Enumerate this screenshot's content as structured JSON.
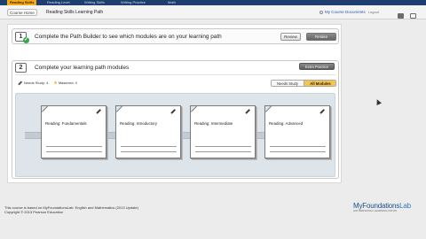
{
  "topbar": {
    "tabs": [
      {
        "label": "Reading Skills",
        "active": true
      },
      {
        "label": "Reading Level",
        "active": false
      },
      {
        "label": "Writing Skills",
        "active": false
      },
      {
        "label": "Writing Practice",
        "active": false
      },
      {
        "label": "Math",
        "active": false
      }
    ]
  },
  "subheader": {
    "course_home": "Course Home",
    "title": "Reading Skills Learning Path",
    "course_docs": "My Course Documents",
    "logout": "Logout"
  },
  "step1": {
    "number": "1",
    "text": "Complete the Path Builder to see which modules are on your learning path",
    "review": "Review",
    "retake": "Retake"
  },
  "step2": {
    "number": "2",
    "text": "Complete your learning path modules",
    "extra_practice": "Extra Practice",
    "needs_study_label": "Needs Study: 4",
    "mastered_label": "Mastered: 0",
    "filter_needs_study": "Needs Study",
    "filter_all": "All Modules",
    "modules": [
      {
        "name": "Reading: Fundamentals"
      },
      {
        "name": "Reading: Introductory"
      },
      {
        "name": "Reading: Intermediate"
      },
      {
        "name": "Reading: Advanced"
      }
    ]
  },
  "footer": {
    "line1": "This course is based on MyFoundationsLab: English and Mathematics (2013 Update)",
    "line2": "Copyright © 2013 Pearson Education"
  },
  "brand": {
    "name_a": "MyFoundations",
    "name_b": "Lab",
    "tagline": "with PERSONAL LEARNING PATHS"
  },
  "colors": {
    "nav_bg": "#1d3e6e",
    "active_tab": "#f3a91a",
    "filter_active": "#f4c451",
    "check_green": "#3aa84a"
  }
}
